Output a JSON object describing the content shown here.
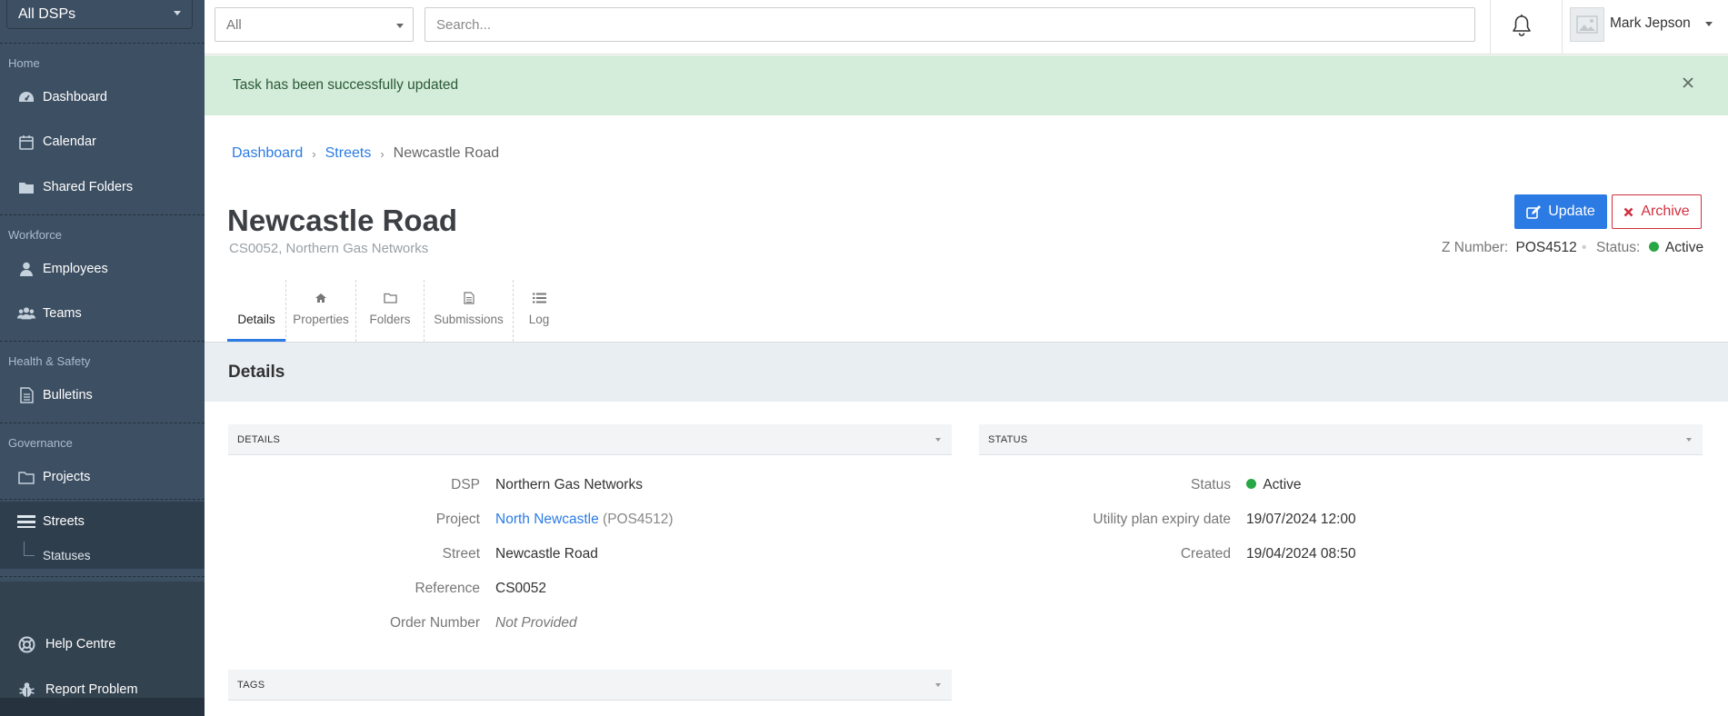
{
  "sidebar": {
    "dsp_select": "All DSPs",
    "sections": {
      "home": "Home",
      "workforce": "Workforce",
      "health_safety": "Health & Safety",
      "governance": "Governance"
    },
    "items": {
      "dashboard": "Dashboard",
      "calendar": "Calendar",
      "shared_folders": "Shared Folders",
      "employees": "Employees",
      "teams": "Teams",
      "bulletins": "Bulletins",
      "projects": "Projects",
      "streets": "Streets",
      "statuses": "Statuses",
      "help_centre": "Help Centre",
      "report_problem": "Report Problem"
    },
    "active_item": "streets"
  },
  "topbar": {
    "filter_value": "All",
    "search_placeholder": "Search...",
    "user_name": "Mark Jepson"
  },
  "alert": {
    "message": "Task has been successfully updated"
  },
  "breadcrumb": {
    "dashboard": "Dashboard",
    "streets": "Streets",
    "current": "Newcastle Road"
  },
  "page": {
    "title": "Newcastle Road",
    "subtitle": "CS0052, Northern Gas Networks",
    "update_label": "Update",
    "archive_label": "Archive",
    "z_number_label": "Z Number:",
    "z_number_value": "POS4512",
    "status_label": "Status:",
    "status_value": "Active"
  },
  "tabs": {
    "details": "Details",
    "properties": "Properties",
    "folders": "Folders",
    "submissions": "Submissions",
    "log": "Log",
    "active": "details"
  },
  "section_title": "Details",
  "details_panel": {
    "header": "DETAILS",
    "dsp_label": "DSP",
    "dsp_value": "Northern Gas Networks",
    "project_label": "Project",
    "project_link": "North Newcastle",
    "project_code": "(POS4512)",
    "street_label": "Street",
    "street_value": "Newcastle Road",
    "reference_label": "Reference",
    "reference_value": "CS0052",
    "order_label": "Order Number",
    "order_value": "Not Provided"
  },
  "status_panel": {
    "header": "STATUS",
    "status_label": "Status",
    "status_value": "Active",
    "expiry_label": "Utility plan expiry date",
    "expiry_value": "19/07/2024 12:00",
    "created_label": "Created",
    "created_value": "19/04/2024 08:50"
  },
  "tags_panel": {
    "header": "TAGS"
  },
  "colors": {
    "accent": "#2c7be5",
    "danger": "#d12f3f",
    "success": "#28a745",
    "sidebar": "#3d4f62",
    "alert_bg": "#d4ecda"
  }
}
